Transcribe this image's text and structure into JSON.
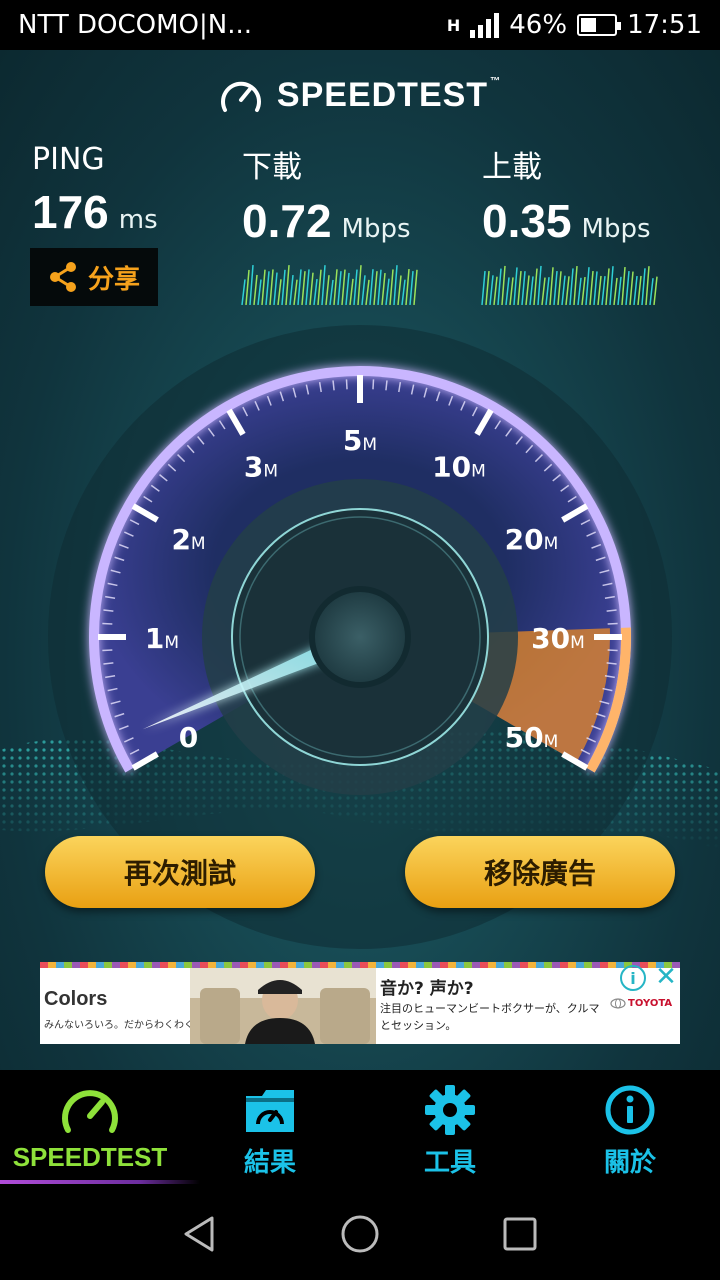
{
  "status_bar": {
    "carrier": "NTT DOCOMO|N...",
    "network": "H",
    "battery_percent": "46%",
    "battery_level": 0.46,
    "time": "17:51"
  },
  "header": {
    "logo": "SPEEDTEST",
    "trademark": "™"
  },
  "results": {
    "ping": {
      "label": "PING",
      "value": "176",
      "unit": "ms"
    },
    "download": {
      "label": "下載",
      "value": "0.72",
      "unit": "Mbps"
    },
    "upload": {
      "label": "上載",
      "value": "0.35",
      "unit": "Mbps"
    }
  },
  "share_button": {
    "label": "分享",
    "icon": "share-icon"
  },
  "gauge": {
    "scale_labels": [
      {
        "num": "0",
        "unit": ""
      },
      {
        "num": "1",
        "unit": "M"
      },
      {
        "num": "2",
        "unit": "M"
      },
      {
        "num": "3",
        "unit": "M"
      },
      {
        "num": "5",
        "unit": "M"
      },
      {
        "num": "10",
        "unit": "M"
      },
      {
        "num": "20",
        "unit": "M"
      },
      {
        "num": "30",
        "unit": "M"
      },
      {
        "num": "50",
        "unit": "M"
      }
    ],
    "arc_color": "#7a5cd6",
    "orange_color": "#e98a25"
  },
  "actions": {
    "retest": "再次測試",
    "remove_ads": "移除廣告"
  },
  "ad": {
    "brand": "Colors",
    "tagline": "みんないろいろ。だからわくわく。",
    "headline": "音か? 声か?",
    "body": "注目のヒューマンビートボクサーが、クルマとセッション。",
    "maker": "TOYOTA",
    "info_icon": "i",
    "close_icon": "✕"
  },
  "tabs": [
    {
      "label": "SPEEDTEST",
      "icon": "speedometer-icon"
    },
    {
      "label": "結果",
      "icon": "results-folder-icon"
    },
    {
      "label": "工具",
      "icon": "gear-icon"
    },
    {
      "label": "關於",
      "icon": "info-icon"
    }
  ],
  "colors": {
    "accent_green": "#8ee13a",
    "accent_cyan": "#1bc2e8",
    "button_gold": "#f2b52e"
  }
}
